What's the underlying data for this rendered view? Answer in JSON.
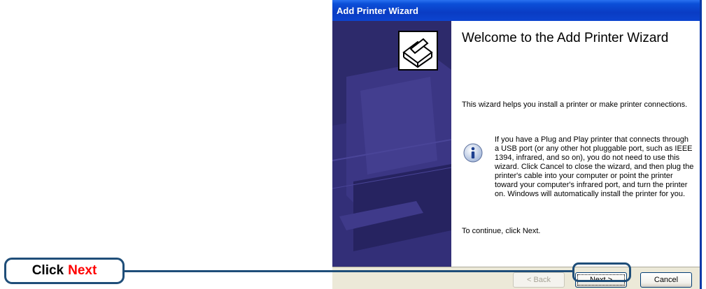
{
  "window": {
    "title": "Add Printer Wizard"
  },
  "content": {
    "heading": "Welcome to the Add Printer Wizard",
    "intro": "This wizard helps you install a printer or make printer connections.",
    "info_icon": "info-icon",
    "info": "If you have a Plug and Play printer that connects through a USB port (or any other hot pluggable port, such as IEEE 1394, infrared, and so on), you do not need to use this wizard. Click Cancel to close the wizard, and then plug the printer's cable into your computer or point the printer toward your computer's infrared port, and turn the printer on. Windows will automatically install the printer for you.",
    "continue": "To continue, click Next."
  },
  "buttons": {
    "back": "< Back",
    "next": "Next >",
    "cancel": "Cancel"
  },
  "callout": {
    "prefix": "Click",
    "highlight": "Next",
    "highlight_color": "#ff0000",
    "border_color": "#1f4e79"
  },
  "colors": {
    "titlebar": "#0b4fd8",
    "side_panel": "#2d2a6b",
    "footer": "#ece9d8"
  }
}
